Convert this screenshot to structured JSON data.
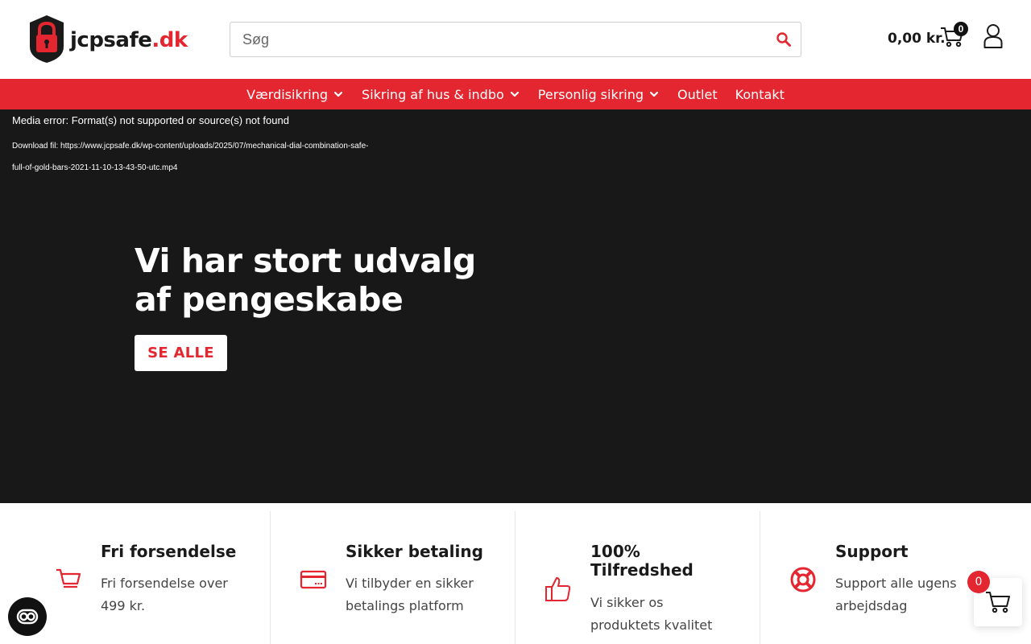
{
  "colors": {
    "brand_red": "#e3262f",
    "hero_bg": "#181818",
    "text_dark": "#1a1a1a"
  },
  "header": {
    "logo": {
      "text_main": "jcpsafe",
      "text_accent": ".dk",
      "icon": "padlock-icon"
    },
    "search": {
      "placeholder": "Søg",
      "icon": "search-icon"
    },
    "cart": {
      "total": "0,00 kr.",
      "count": "0",
      "icon": "shopping-cart-icon"
    },
    "account": {
      "icon": "user-icon"
    }
  },
  "nav": {
    "items": [
      {
        "label": "Værdisikring",
        "has_dropdown": true
      },
      {
        "label": "Sikring af hus & indbo",
        "has_dropdown": true
      },
      {
        "label": "Personlig sikring",
        "has_dropdown": true
      },
      {
        "label": "Outlet",
        "has_dropdown": false
      },
      {
        "label": "Kontakt",
        "has_dropdown": false
      }
    ]
  },
  "hero": {
    "media_error": "Media error: Format(s) not supported or source(s) not found",
    "media_download": "Download fil: https://www.jcpsafe.dk/wp-content/uploads/2025/07/mechanical-dial-combination-safe-full-of-gold-bars-2021-11-10-13-43-50-utc.mp4",
    "title_line1": "Vi har stort udvalg",
    "title_line2": "af pengeskabe",
    "cta_label": "SE ALLE"
  },
  "features": [
    {
      "icon": "cart-icon",
      "title": "Fri forsendelse",
      "text_line1": "Fri forsendelse over",
      "text_line2": "499 kr."
    },
    {
      "icon": "credit-card-icon",
      "title": "Sikker betaling",
      "text_line1": "Vi tilbyder en sikker",
      "text_line2": "betalings platform"
    },
    {
      "icon": "thumbs-up-icon",
      "title_line1": "100%",
      "title_line2": "Tilfredshed",
      "text_line1": "Vi sikker os",
      "text_line2": "produktets kvalitet"
    },
    {
      "icon": "lifebuoy-icon",
      "title": "Support",
      "text_line1": "Support alle ugens",
      "text_line2": "arbejdsdag"
    }
  ],
  "floating": {
    "accessibility": {
      "icon": "accessibility-toggle-icon"
    },
    "cart": {
      "count": "0",
      "icon": "cart-icon"
    }
  }
}
